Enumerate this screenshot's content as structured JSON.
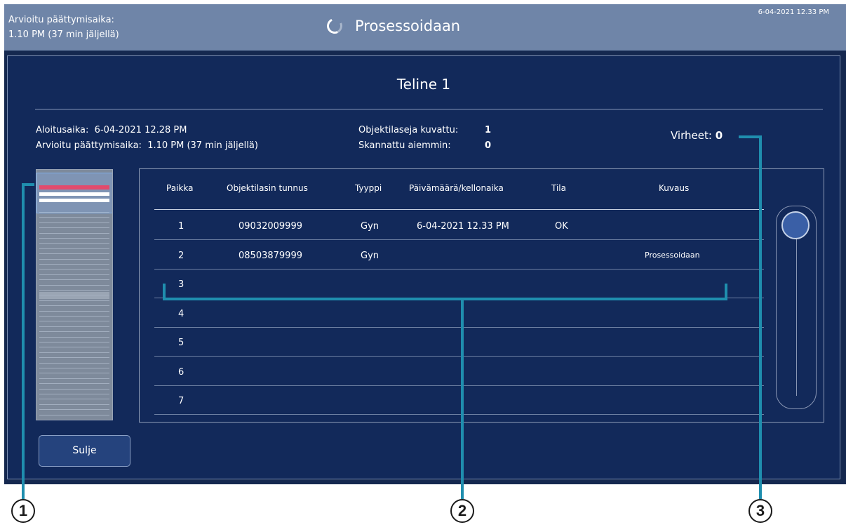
{
  "topbar": {
    "eta_line1": "Arvioitu päättymisaika:",
    "eta_line2": "1.10 PM (37 min jäljellä)",
    "status_title": "Prosessoidaan",
    "datetime": "6-04-2021 12.33 PM"
  },
  "panel": {
    "title": "Teline 1",
    "start_label": "Aloitusaika:",
    "start_value": "6-04-2021 12.28 PM",
    "eta_label": "Arvioitu päättymisaika:",
    "eta_value": "1.10 PM (37 min jäljellä)",
    "imaged_label": "Objektilaseja kuvattu:",
    "imaged_value": "1",
    "scanned_label": "Skannattu aiemmin:",
    "scanned_value": "0",
    "errors_label": "Virheet:",
    "errors_value": "0"
  },
  "table": {
    "headers": [
      "Paikka",
      "Objektilasin tunnus",
      "Tyyppi",
      "Päivämäärä/kellonaika",
      "Tila",
      "Kuvaus"
    ],
    "rows": [
      {
        "pos": "1",
        "id": "09032009999",
        "type": "Gyn",
        "datetime": "6-04-2021 12.33 PM",
        "status": "OK",
        "desc": ""
      },
      {
        "pos": "2",
        "id": "08503879999",
        "type": "Gyn",
        "datetime": "",
        "status": "",
        "desc": "Prosessoidaan"
      },
      {
        "pos": "3",
        "id": "",
        "type": "",
        "datetime": "",
        "status": "",
        "desc": ""
      },
      {
        "pos": "4",
        "id": "",
        "type": "",
        "datetime": "",
        "status": "",
        "desc": ""
      },
      {
        "pos": "5",
        "id": "",
        "type": "",
        "datetime": "",
        "status": "",
        "desc": ""
      },
      {
        "pos": "6",
        "id": "",
        "type": "",
        "datetime": "",
        "status": "",
        "desc": ""
      },
      {
        "pos": "7",
        "id": "",
        "type": "",
        "datetime": "",
        "status": "",
        "desc": ""
      }
    ]
  },
  "buttons": {
    "close_label": "Sulje"
  },
  "callouts": [
    "1",
    "2",
    "3"
  ],
  "colors": {
    "accent": "#1f8eae",
    "error_slot": "#e24a6c",
    "topbar": "#6f85a8",
    "panel": "#12295a"
  }
}
